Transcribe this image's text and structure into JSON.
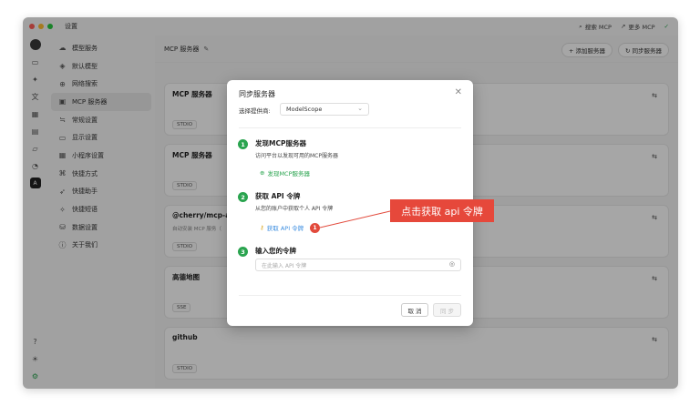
{
  "window": {
    "title": "设置"
  },
  "titlebar": {
    "search_mcp": "搜索 MCP",
    "more_mcp": "更多 MCP"
  },
  "menu": {
    "items": [
      {
        "icon": "cloud-icon",
        "label": "模型服务"
      },
      {
        "icon": "cube-icon",
        "label": "默认模型"
      },
      {
        "icon": "globe-icon",
        "label": "网络搜索"
      },
      {
        "icon": "terminal-icon",
        "label": "MCP 服务器"
      },
      {
        "icon": "sliders-icon",
        "label": "常规设置"
      },
      {
        "icon": "monitor-icon",
        "label": "显示设置"
      },
      {
        "icon": "grid-icon",
        "label": "小程序设置"
      },
      {
        "icon": "command-icon",
        "label": "快捷方式"
      },
      {
        "icon": "rocket-icon",
        "label": "快捷助手"
      },
      {
        "icon": "sparkle-icon",
        "label": "快捷短语"
      },
      {
        "icon": "database-icon",
        "label": "数据设置"
      },
      {
        "icon": "info-icon",
        "label": "关于我们"
      }
    ]
  },
  "main": {
    "header_title": "MCP 服务器",
    "add_server": "+ 添加服务器",
    "sync_server": "同步服务器",
    "cards": [
      {
        "title": "MCP 服务器",
        "desc": "",
        "tag": "STDIO"
      },
      {
        "title": "MCP 服务器",
        "desc": "",
        "tag": "STDIO"
      },
      {
        "title": "@cherry/mcp-aut",
        "desc": "自动安装 MCP 服务（",
        "tag": "STDIO"
      },
      {
        "title": "高德地图",
        "desc": "",
        "tag": "SSE"
      },
      {
        "title": "github",
        "desc": "",
        "tag": "STDIO"
      }
    ]
  },
  "dialog": {
    "title": "同步服务器",
    "provider_label": "选择提供商:",
    "provider_value": "ModelScope",
    "steps": [
      {
        "num": "1",
        "title": "发现MCP服务器",
        "desc": "访问平台以发现可用的MCP服务器",
        "link": "发现MCP服务器"
      },
      {
        "num": "2",
        "title": "获取 API 令牌",
        "desc": "从您的账户中获取个人 API 令牌",
        "link": "获取 API 令牌"
      },
      {
        "num": "3",
        "title": "输入您的令牌",
        "placeholder": "在此输入 API 令牌"
      }
    ],
    "cancel": "取 消",
    "sync": "同 步"
  },
  "annotation": {
    "badge": "1",
    "callout": "点击获取 api 令牌"
  },
  "colors": {
    "accent_green": "#2aa44f",
    "callout_red": "#e6483b",
    "link_blue": "#3c8ee0"
  }
}
